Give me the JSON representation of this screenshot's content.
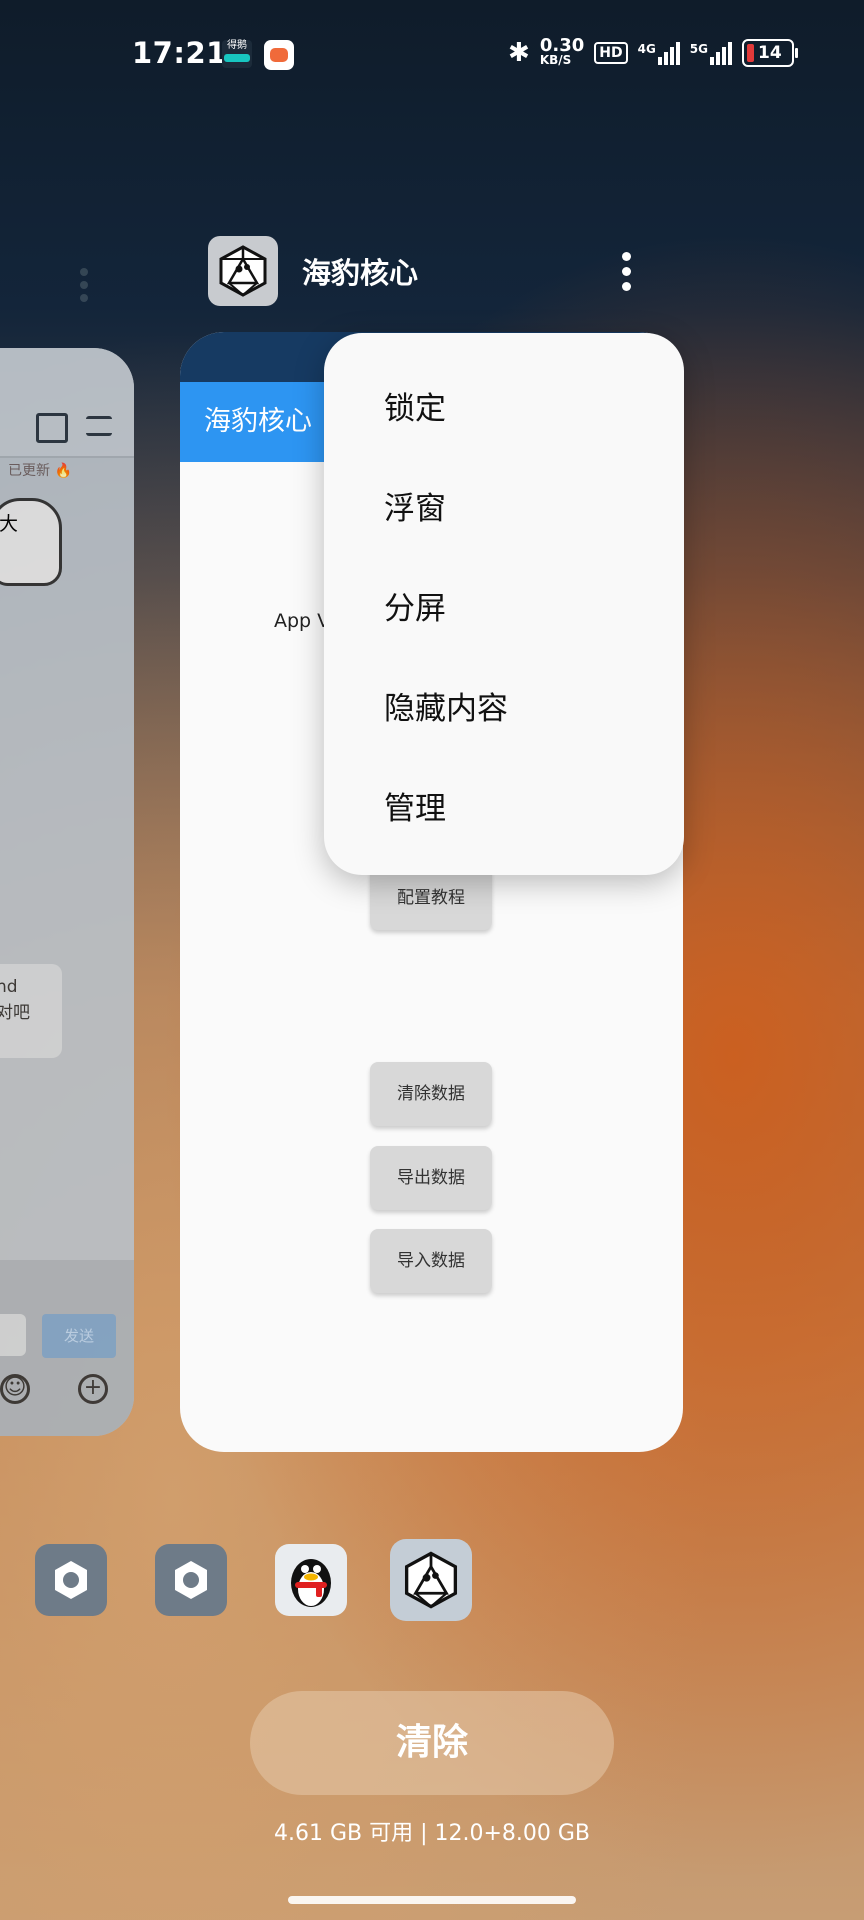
{
  "status_bar": {
    "time": "17:21",
    "app1_label": "得鹅",
    "speed_value": "0.30",
    "speed_unit": "KB/S",
    "hd_label": "HD",
    "net1": "4G",
    "net2": "5G",
    "battery": "14"
  },
  "recent_app": {
    "title": "海豹核心"
  },
  "main_card": {
    "appbar_title": "海豹核心",
    "app_version_partial": "App V",
    "buttons": {
      "config_tutorial": "配置教程",
      "clear_data": "清除数据",
      "export_data": "导出数据",
      "import_data": "导入数据"
    }
  },
  "menu": {
    "lock": "锁定",
    "float": "浮窗",
    "split": "分屏",
    "hide": "隐藏内容",
    "manage": "管理"
  },
  "left_card": {
    "update_text": "已更新",
    "sticker_text": "大",
    "bubble_text_1": "nd",
    "bubble_text_2": "对吧",
    "send_label": "发送"
  },
  "dock": {
    "icons": [
      "settings-icon",
      "settings-icon",
      "qq-penguin-icon",
      "d20-dice-icon"
    ]
  },
  "bottom": {
    "clear_label": "清除",
    "memory": "4.61 GB 可用 | 12.0+8.00 GB"
  },
  "colors": {
    "appbar_blue": "#2d95f2",
    "card_top": "#163a62",
    "battery_low": "#e23a3a"
  }
}
